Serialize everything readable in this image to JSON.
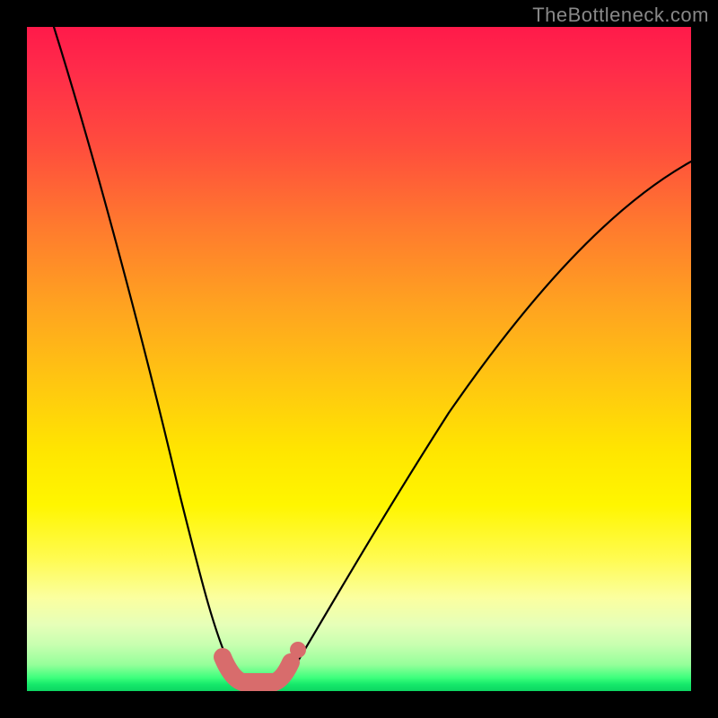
{
  "watermark": "TheBottleneck.com",
  "colors": {
    "marker": "#d86c6c",
    "curve": "#000000",
    "frame": "#000000"
  },
  "chart_data": {
    "type": "line",
    "title": "",
    "xlabel": "",
    "ylabel": "",
    "x": [
      0,
      5,
      10,
      15,
      20,
      22,
      25,
      28,
      30,
      32,
      34,
      36,
      38,
      40,
      45,
      50,
      55,
      60,
      70,
      80,
      90,
      100
    ],
    "bottleneck_percent": [
      100,
      85,
      70,
      53,
      35,
      25,
      15,
      6,
      2,
      0,
      0,
      0,
      2,
      6,
      15,
      25,
      33,
      40,
      50,
      58,
      63,
      66
    ],
    "optimal_range_x": [
      28,
      38
    ],
    "xlim": [
      0,
      100
    ],
    "ylim": [
      0,
      100
    ],
    "note": "V-shaped bottleneck curve over a vertical gradient from red (high bottleneck) to green (0%)."
  }
}
